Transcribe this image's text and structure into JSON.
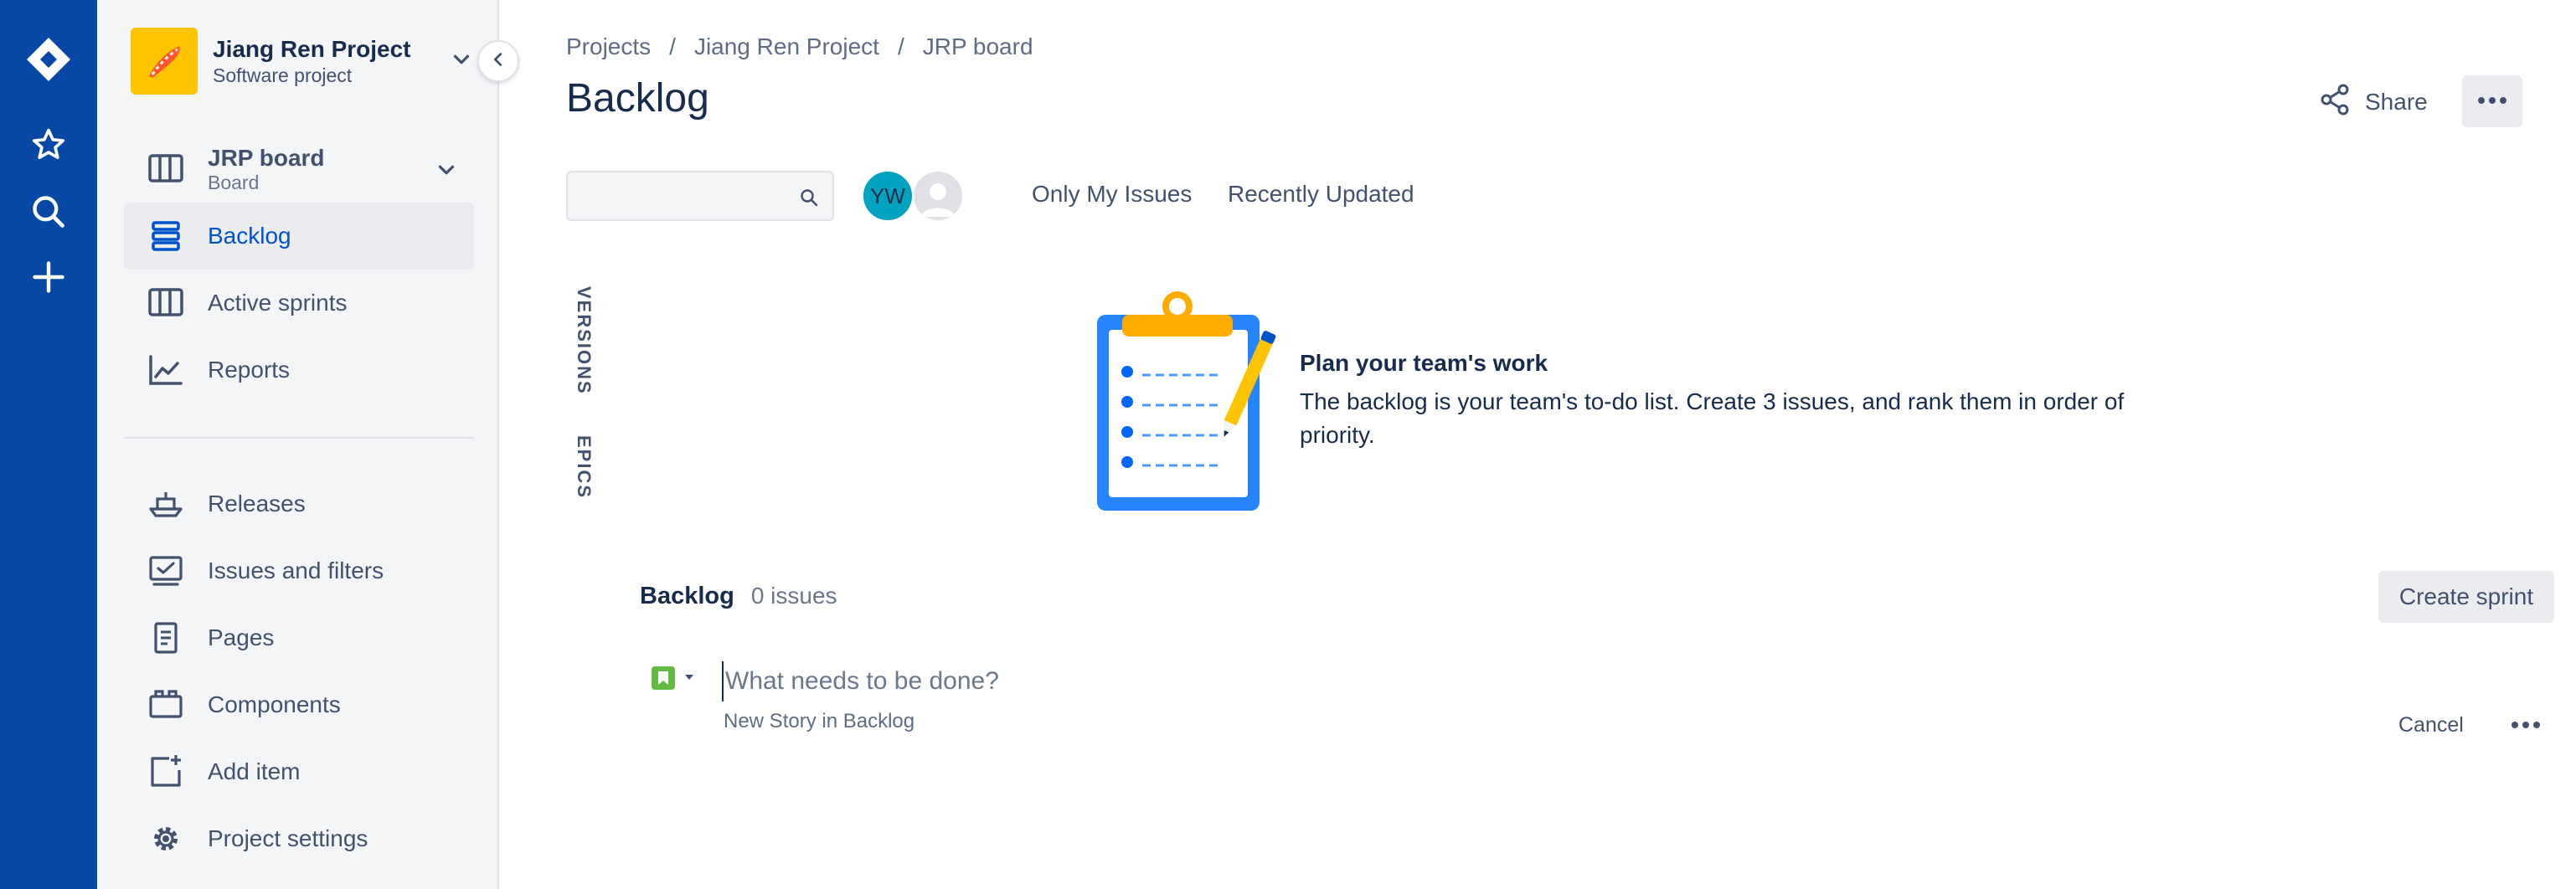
{
  "global_nav": {
    "items": [
      {
        "icon": "jira-logo-icon"
      },
      {
        "icon": "star-icon"
      },
      {
        "icon": "search-icon"
      },
      {
        "icon": "plus-icon"
      }
    ]
  },
  "project": {
    "name": "Jiang Ren Project",
    "type": "Software project"
  },
  "sidebar": {
    "board": {
      "title": "JRP board",
      "subtitle": "Board"
    },
    "items": [
      {
        "label": "Backlog",
        "icon": "backlog-icon",
        "selected": true
      },
      {
        "label": "Active sprints",
        "icon": "columns-icon"
      },
      {
        "label": "Reports",
        "icon": "chart-icon"
      }
    ],
    "secondary_items": [
      {
        "label": "Releases",
        "icon": "ship-icon"
      },
      {
        "label": "Issues and filters",
        "icon": "issues-icon"
      },
      {
        "label": "Pages",
        "icon": "page-icon"
      },
      {
        "label": "Components",
        "icon": "component-icon"
      },
      {
        "label": "Add item",
        "icon": "add-item-icon"
      },
      {
        "label": "Project settings",
        "icon": "gear-icon"
      }
    ]
  },
  "breadcrumbs": [
    "Projects",
    "Jiang Ren Project",
    "JRP board"
  ],
  "breadcrumb_separator": "/",
  "page": {
    "title": "Backlog",
    "share_label": "Share"
  },
  "filters": {
    "search_value": "",
    "avatar_initials": "YW",
    "quick_filters": [
      "Only My Issues",
      "Recently Updated"
    ]
  },
  "side_tabs": [
    "VERSIONS",
    "EPICS"
  ],
  "empty_state": {
    "title": "Plan your team's work",
    "description": "The backlog is your team's to-do list. Create 3 issues, and rank them in order of priority."
  },
  "backlog": {
    "title": "Backlog",
    "count": "0 issues",
    "create_sprint_label": "Create sprint",
    "new_issue_placeholder": "What needs to be done?",
    "new_issue_hint": "New Story in Backlog",
    "cancel_label": "Cancel"
  },
  "colors": {
    "global_nav": "#0747a6",
    "sidebar_bg": "#f4f5f7",
    "selected_text": "#0052cc",
    "avatar_bg": "#00a3bf",
    "project_avatar": "#ffc400",
    "story_icon": "#65ba43"
  }
}
